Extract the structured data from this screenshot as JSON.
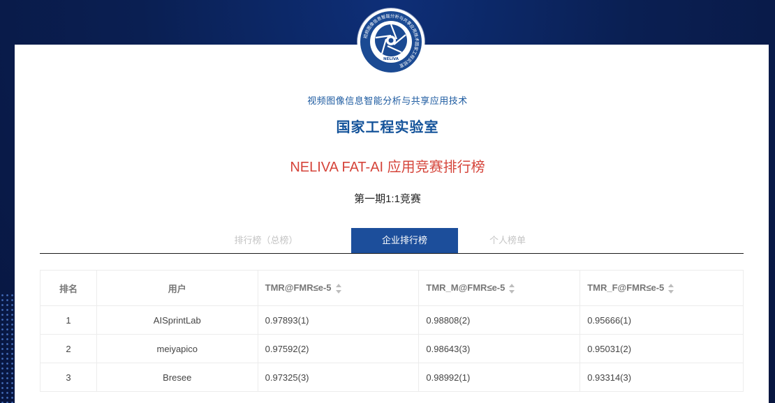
{
  "header": {
    "subtitle": "视频图像信息智能分析与共享应用技术",
    "lab_title": "国家工程实验室",
    "contest_title": "NELIVA FAT-AI 应用竞赛排行榜",
    "phase": "第一期1:1竞赛",
    "logo_icon": "aperture-seal-icon",
    "logo_text": "NELIVA",
    "logo_ring_text": "视频图像信息智能分析与共享应用技术国家工程实验室"
  },
  "tabs": [
    {
      "label": "排行榜（总榜）",
      "active": false
    },
    {
      "label": "企业排行榜",
      "active": true
    },
    {
      "label": "个人榜单",
      "active": false
    }
  ],
  "table": {
    "columns": [
      "排名",
      "用户",
      "TMR@FMR≤e-5",
      "TMR_M@FMR≤e-5",
      "TMR_F@FMR≤e-5"
    ],
    "rows": [
      [
        "1",
        "AISprintLab",
        "0.97893(1)",
        "0.98808(2)",
        "0.95666(1)"
      ],
      [
        "2",
        "meiyapico",
        "0.97592(2)",
        "0.98643(3)",
        "0.95031(2)"
      ],
      [
        "3",
        "Bresee",
        "0.97325(3)",
        "0.98992(1)",
        "0.93314(3)"
      ]
    ]
  },
  "colors": {
    "background": "#0a1f52",
    "accent_blue": "#1c4e9b",
    "title_red": "#d5443a",
    "title_blue": "#14539a"
  }
}
